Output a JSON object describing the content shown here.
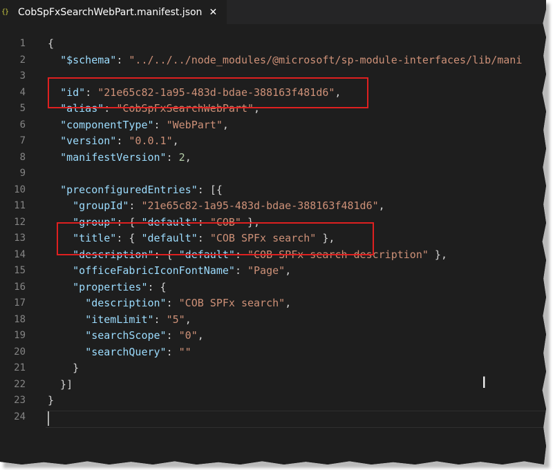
{
  "tab": {
    "icon": "{}",
    "title": "CobSpFxSearchWebPart.manifest.json",
    "close": "✕"
  },
  "lines": [
    {
      "n": "1",
      "tokens": [
        [
          "p",
          "{"
        ]
      ]
    },
    {
      "n": "2",
      "tokens": [
        [
          "p",
          "  "
        ],
        [
          "k",
          "\"$schema\""
        ],
        [
          "p",
          ": "
        ],
        [
          "s",
          "\"../../../node_modules/@microsoft/sp-module-interfaces/lib/mani"
        ]
      ]
    },
    {
      "n": "3",
      "tokens": []
    },
    {
      "n": "4",
      "tokens": [
        [
          "p",
          "  "
        ],
        [
          "k",
          "\"id\""
        ],
        [
          "p",
          ": "
        ],
        [
          "s",
          "\"21e65c82-1a95-483d-bdae-388163f481d6\""
        ],
        [
          "p",
          ","
        ]
      ]
    },
    {
      "n": "5",
      "tokens": [
        [
          "p",
          "  "
        ],
        [
          "k",
          "\"alias\""
        ],
        [
          "p",
          ": "
        ],
        [
          "s",
          "\"CobSpFxSearchWebPart\""
        ],
        [
          "p",
          ","
        ]
      ]
    },
    {
      "n": "6",
      "tokens": [
        [
          "p",
          "  "
        ],
        [
          "k",
          "\"componentType\""
        ],
        [
          "p",
          ": "
        ],
        [
          "s",
          "\"WebPart\""
        ],
        [
          "p",
          ","
        ]
      ]
    },
    {
      "n": "7",
      "tokens": [
        [
          "p",
          "  "
        ],
        [
          "k",
          "\"version\""
        ],
        [
          "p",
          ": "
        ],
        [
          "s",
          "\"0.0.1\""
        ],
        [
          "p",
          ","
        ]
      ]
    },
    {
      "n": "8",
      "tokens": [
        [
          "p",
          "  "
        ],
        [
          "k",
          "\"manifestVersion\""
        ],
        [
          "p",
          ": "
        ],
        [
          "n",
          "2"
        ],
        [
          "p",
          ","
        ]
      ]
    },
    {
      "n": "9",
      "tokens": []
    },
    {
      "n": "10",
      "tokens": [
        [
          "p",
          "  "
        ],
        [
          "k",
          "\"preconfiguredEntries\""
        ],
        [
          "p",
          ": [{"
        ]
      ]
    },
    {
      "n": "11",
      "tokens": [
        [
          "p",
          "    "
        ],
        [
          "k",
          "\"groupId\""
        ],
        [
          "p",
          ": "
        ],
        [
          "s",
          "\"21e65c82-1a95-483d-bdae-388163f481d6\""
        ],
        [
          "p",
          ","
        ]
      ]
    },
    {
      "n": "12",
      "tokens": [
        [
          "p",
          "    "
        ],
        [
          "k",
          "\"group\""
        ],
        [
          "p",
          ": { "
        ],
        [
          "k",
          "\"default\""
        ],
        [
          "p",
          ": "
        ],
        [
          "s",
          "\"COB\""
        ],
        [
          "p",
          " },"
        ]
      ]
    },
    {
      "n": "13",
      "tokens": [
        [
          "p",
          "    "
        ],
        [
          "k",
          "\"title\""
        ],
        [
          "p",
          ": { "
        ],
        [
          "k",
          "\"default\""
        ],
        [
          "p",
          ": "
        ],
        [
          "s",
          "\"COB SPFx search\""
        ],
        [
          "p",
          " },"
        ]
      ]
    },
    {
      "n": "14",
      "tokens": [
        [
          "p",
          "    "
        ],
        [
          "k",
          "\"description\""
        ],
        [
          "p",
          ": { "
        ],
        [
          "k",
          "\"default\""
        ],
        [
          "p",
          ": "
        ],
        [
          "s",
          "\"COB SPFx search description\""
        ],
        [
          "p",
          " },"
        ]
      ]
    },
    {
      "n": "15",
      "tokens": [
        [
          "p",
          "    "
        ],
        [
          "k",
          "\"officeFabricIconFontName\""
        ],
        [
          "p",
          ": "
        ],
        [
          "s",
          "\"Page\""
        ],
        [
          "p",
          ","
        ]
      ]
    },
    {
      "n": "16",
      "tokens": [
        [
          "p",
          "    "
        ],
        [
          "k",
          "\"properties\""
        ],
        [
          "p",
          ": {"
        ]
      ]
    },
    {
      "n": "17",
      "tokens": [
        [
          "p",
          "      "
        ],
        [
          "k",
          "\"description\""
        ],
        [
          "p",
          ": "
        ],
        [
          "s",
          "\"COB SPFx search\""
        ],
        [
          "p",
          ","
        ]
      ]
    },
    {
      "n": "18",
      "tokens": [
        [
          "p",
          "      "
        ],
        [
          "k",
          "\"itemLimit\""
        ],
        [
          "p",
          ": "
        ],
        [
          "s",
          "\"5\""
        ],
        [
          "p",
          ","
        ]
      ]
    },
    {
      "n": "19",
      "tokens": [
        [
          "p",
          "      "
        ],
        [
          "k",
          "\"searchScope\""
        ],
        [
          "p",
          ": "
        ],
        [
          "s",
          "\"0\""
        ],
        [
          "p",
          ","
        ]
      ]
    },
    {
      "n": "20",
      "tokens": [
        [
          "p",
          "      "
        ],
        [
          "k",
          "\"searchQuery\""
        ],
        [
          "p",
          ": "
        ],
        [
          "s",
          "\"\""
        ]
      ]
    },
    {
      "n": "21",
      "tokens": [
        [
          "p",
          "    }"
        ]
      ]
    },
    {
      "n": "22",
      "tokens": [
        [
          "p",
          "  }]"
        ]
      ]
    },
    {
      "n": "23",
      "tokens": [
        [
          "p",
          "}"
        ]
      ]
    },
    {
      "n": "24",
      "tokens": []
    }
  ],
  "colors": {
    "editor_bg": "#1e1e1e",
    "key": "#9cdcfe",
    "string": "#ce9178",
    "number": "#b5cea8",
    "punctuation": "#d4d4d4",
    "line_number": "#858585",
    "highlight_box": "#e02020"
  }
}
